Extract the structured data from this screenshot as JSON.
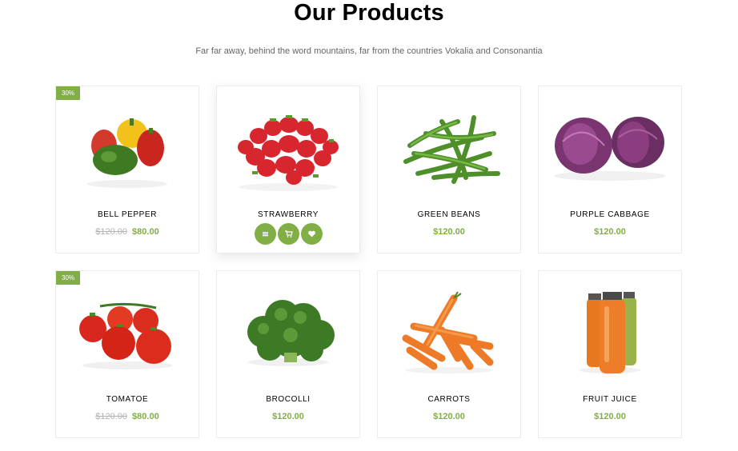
{
  "header": {
    "title": "Our Products",
    "subtitle": "Far far away, behind the word mountains, far from the countries Vokalia and Consonantia"
  },
  "colors": {
    "accent": "#82ae46",
    "old_price": "#b3b3b3",
    "text": "#000000"
  },
  "products": [
    {
      "name": "BELL PEPPER",
      "badge": "30%",
      "old_price": "$120.00",
      "price": "$80.00",
      "icon": "bell-pepper-image"
    },
    {
      "name": "STRAWBERRY",
      "price": "$120.00",
      "hovered": true,
      "actions": [
        "menu-icon",
        "cart-icon",
        "heart-icon"
      ],
      "icon": "strawberry-image"
    },
    {
      "name": "GREEN BEANS",
      "price": "$120.00",
      "icon": "green-beans-image"
    },
    {
      "name": "PURPLE CABBAGE",
      "price": "$120.00",
      "icon": "purple-cabbage-image"
    },
    {
      "name": "TOMATOE",
      "badge": "30%",
      "old_price": "$120.00",
      "price": "$80.00",
      "icon": "tomato-image"
    },
    {
      "name": "BROCOLLI",
      "price": "$120.00",
      "icon": "broccoli-image"
    },
    {
      "name": "CARROTS",
      "price": "$120.00",
      "icon": "carrots-image"
    },
    {
      "name": "FRUIT JUICE",
      "price": "$120.00",
      "icon": "fruit-juice-image"
    }
  ]
}
